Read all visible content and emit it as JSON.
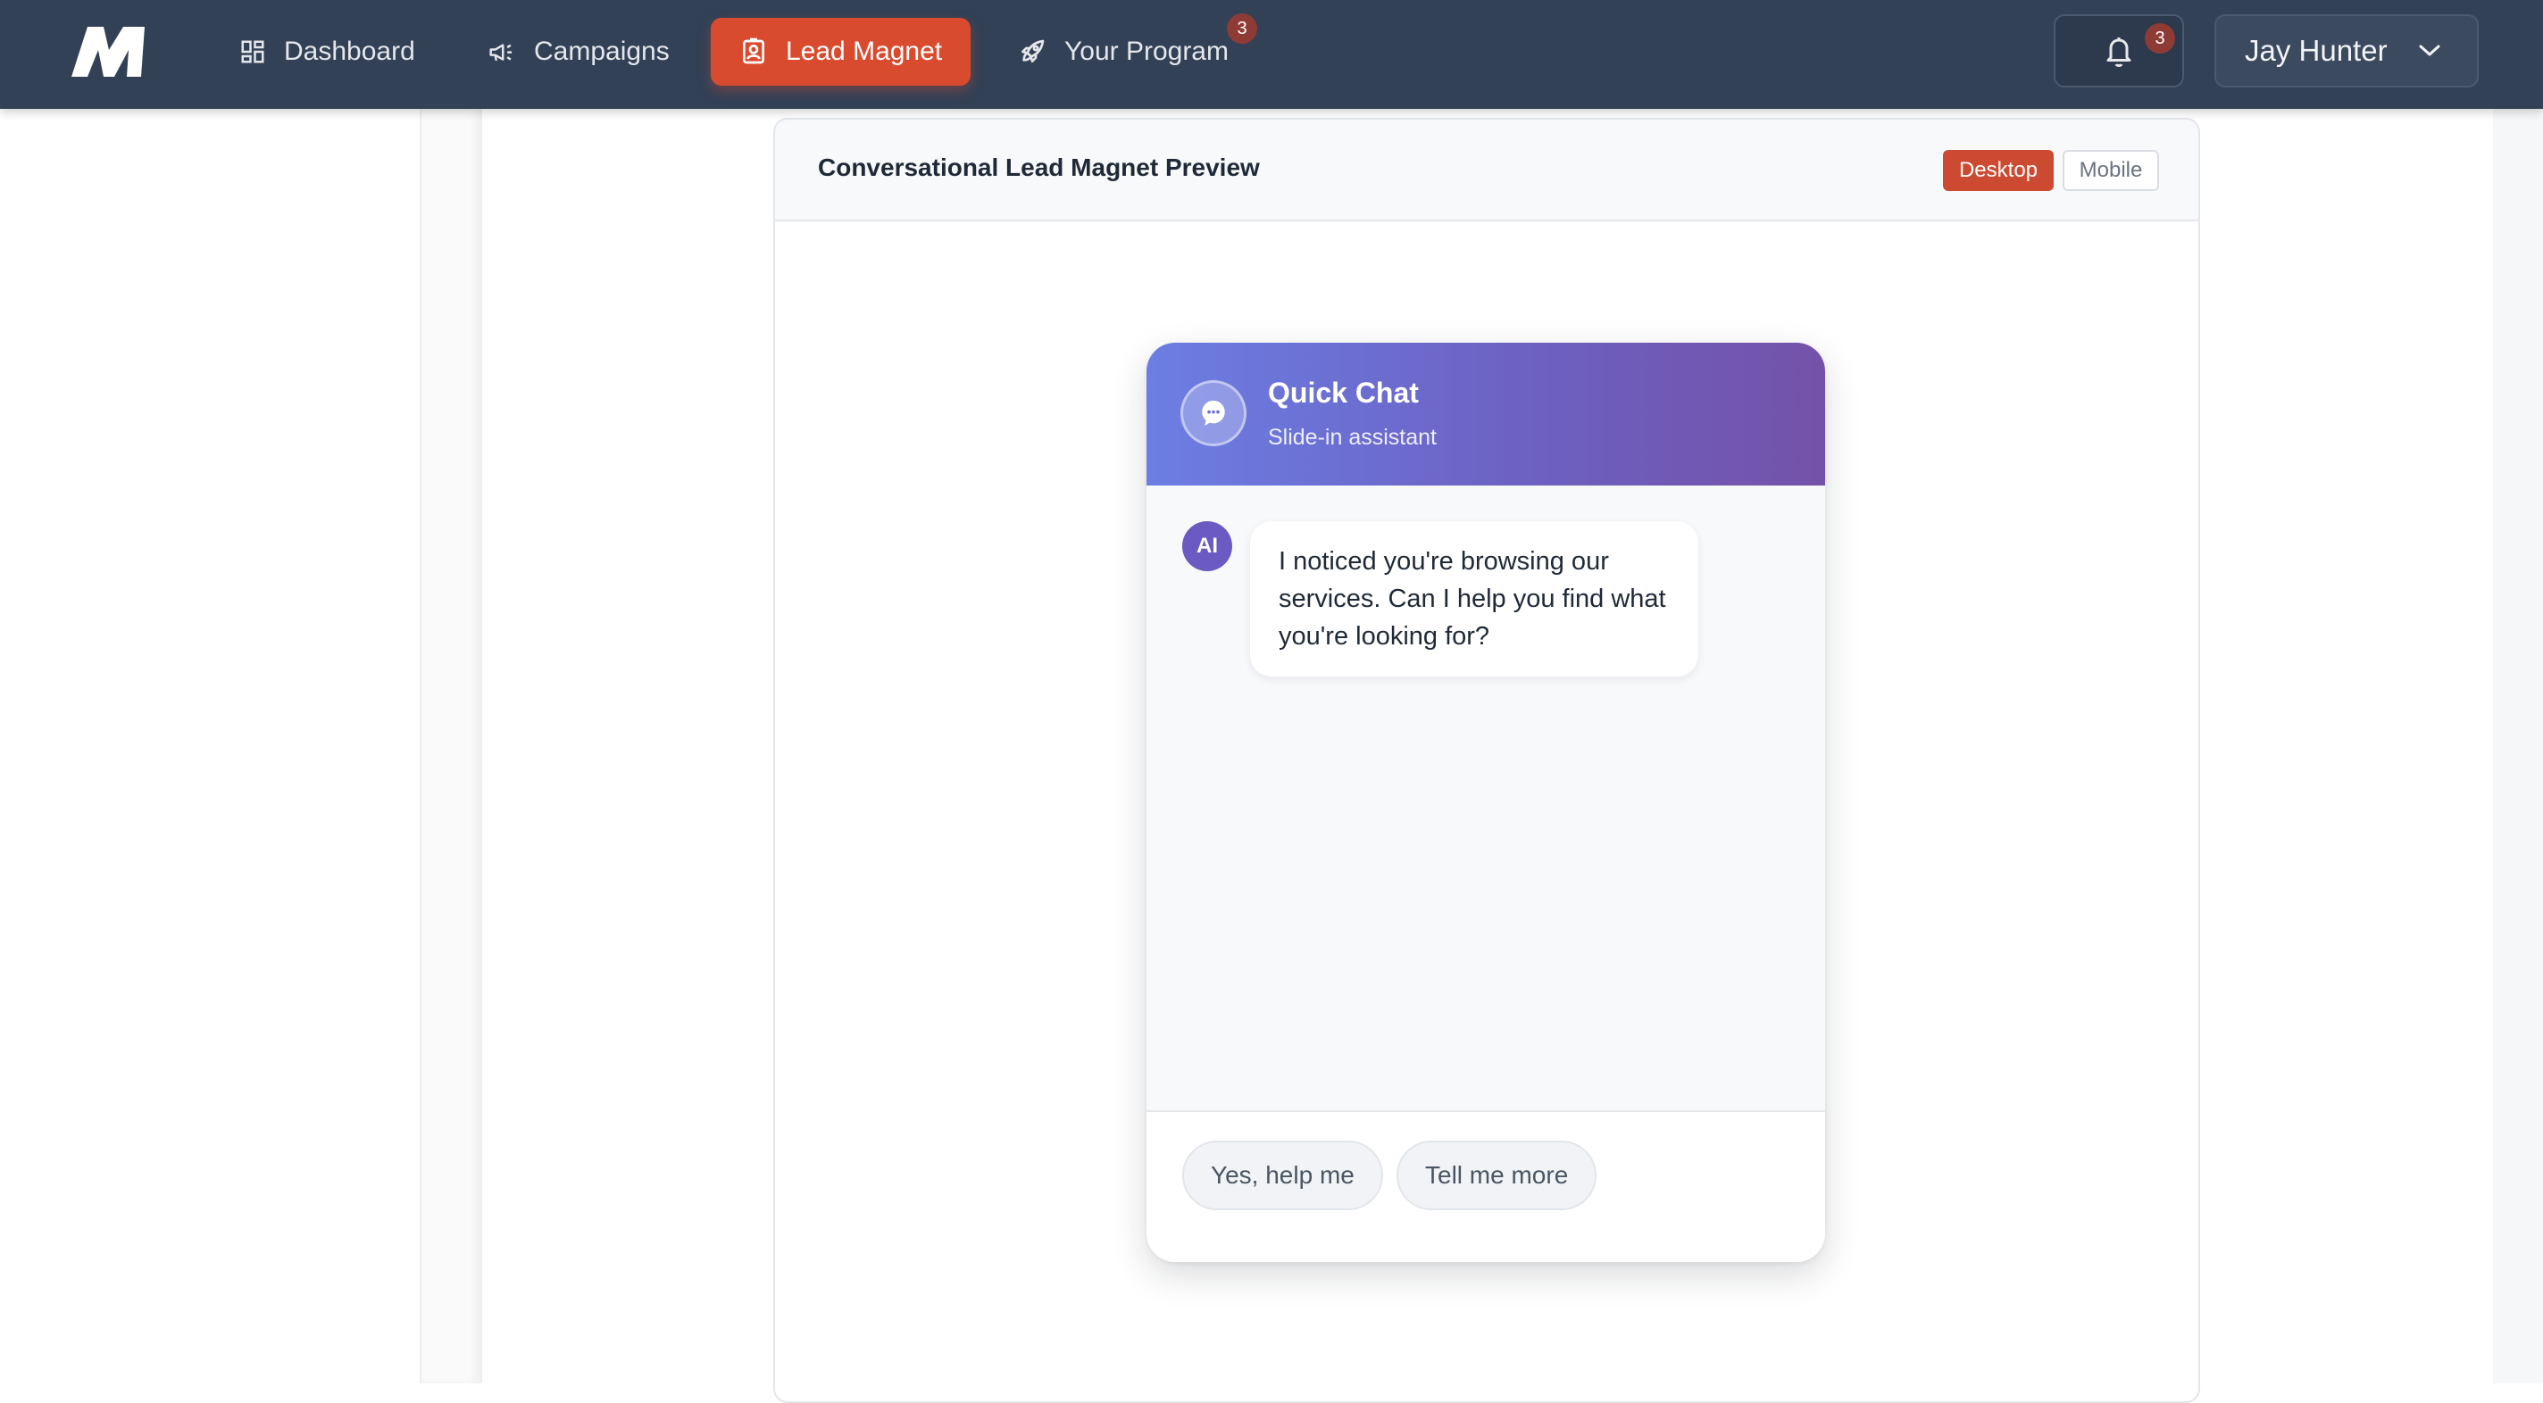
{
  "nav": {
    "items": [
      {
        "label": "Dashboard",
        "icon": "dashboard-icon"
      },
      {
        "label": "Campaigns",
        "icon": "megaphone-icon"
      },
      {
        "label": "Lead Magnet",
        "icon": "contact-card-icon",
        "active": true
      },
      {
        "label": "Your Program",
        "icon": "rocket-icon",
        "badge": "3"
      }
    ],
    "notifications_badge": "3",
    "user_name": "Jay Hunter",
    "accent_color": "#d94b2f",
    "bar_color": "#324156"
  },
  "preview": {
    "title": "Conversational Lead Magnet Preview",
    "toggle": {
      "desktop": "Desktop",
      "mobile": "Mobile",
      "selected": "Desktop"
    }
  },
  "chat": {
    "title": "Quick Chat",
    "subtitle": "Slide-in assistant",
    "avatar_label": "AI",
    "message": "I noticed you're browsing our services. Can I help you find what you're looking for?",
    "quick_replies": [
      "Yes, help me",
      "Tell me more"
    ],
    "header_gradient": [
      "#6c7ee3",
      "#7452a8"
    ]
  }
}
